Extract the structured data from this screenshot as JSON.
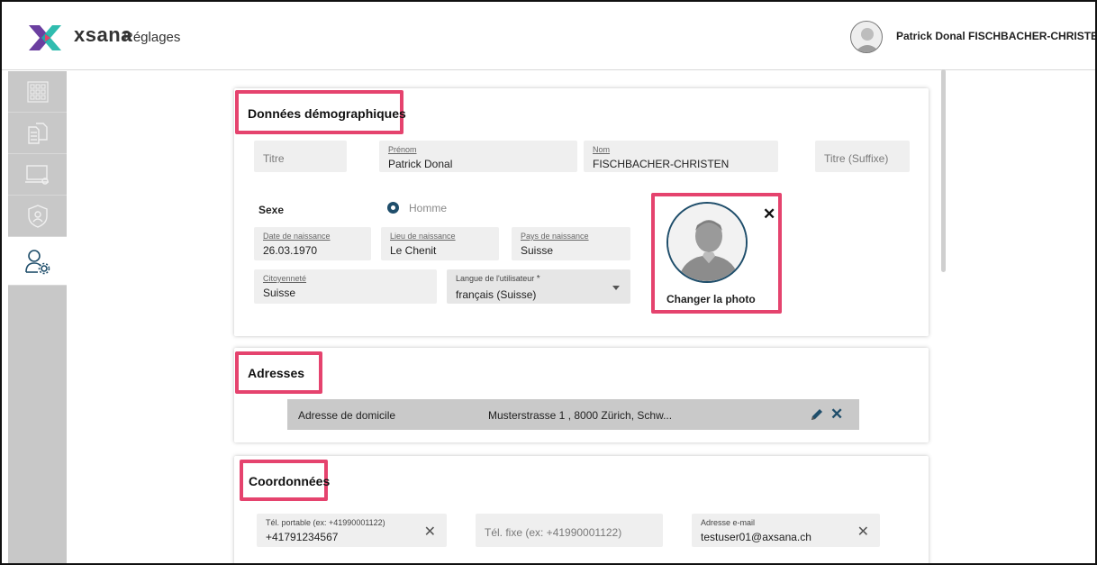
{
  "header": {
    "brand": "xsana",
    "title": "Réglages",
    "user_name": "Patrick Donal FISCHBACHER-CHRISTEN"
  },
  "sidebar": {
    "items": [
      {
        "icon": "grid-icon"
      },
      {
        "icon": "documents-icon"
      },
      {
        "icon": "computer-settings-icon"
      },
      {
        "icon": "security-shield-icon"
      },
      {
        "icon": "user-settings-icon",
        "active": true
      }
    ]
  },
  "demographics": {
    "title": "Données démographiques",
    "titre_placeholder": "Titre",
    "prenom_label": "Prénom",
    "prenom_value": "Patrick Donal",
    "nom_label": "Nom",
    "nom_value": "FISCHBACHER-CHRISTEN",
    "suffix_placeholder": "Titre (Suffixe)",
    "sexe_label": "Sexe",
    "sexe_option": "Homme",
    "dob_label": "Date de naissance",
    "dob_value": "26.03.1970",
    "birthplace_label": "Lieu de naissance",
    "birthplace_value": "Le Chenit",
    "birthcountry_label": "Pays de naissance",
    "birthcountry_value": "Suisse",
    "citizenship_label": "Citoyenneté",
    "citizenship_value": "Suisse",
    "language_label": "Langue de l'utilisateur",
    "language_required": "*",
    "language_value": "français (Suisse)",
    "photo_change": "Changer la photo",
    "photo_close": "✕"
  },
  "addresses": {
    "title": "Adresses",
    "rows": [
      {
        "type": "Adresse de domicile",
        "value": "Musterstrasse 1 , 8000 Zürich, Schw..."
      }
    ],
    "delete": "✕"
  },
  "contacts": {
    "title": "Coordonnées",
    "mobile_label": "Tél. portable (ex: +41990001122)",
    "mobile_value": "+41791234567",
    "landline_placeholder": "Tél. fixe (ex: +41990001122)",
    "email_label": "Adresse e-mail",
    "email_value": "testuser01@axsana.ch",
    "clear": "✕"
  },
  "colors": {
    "highlight": "#e5436e",
    "accent": "#1f4e6b",
    "sidebar": "#c8c8c8"
  }
}
